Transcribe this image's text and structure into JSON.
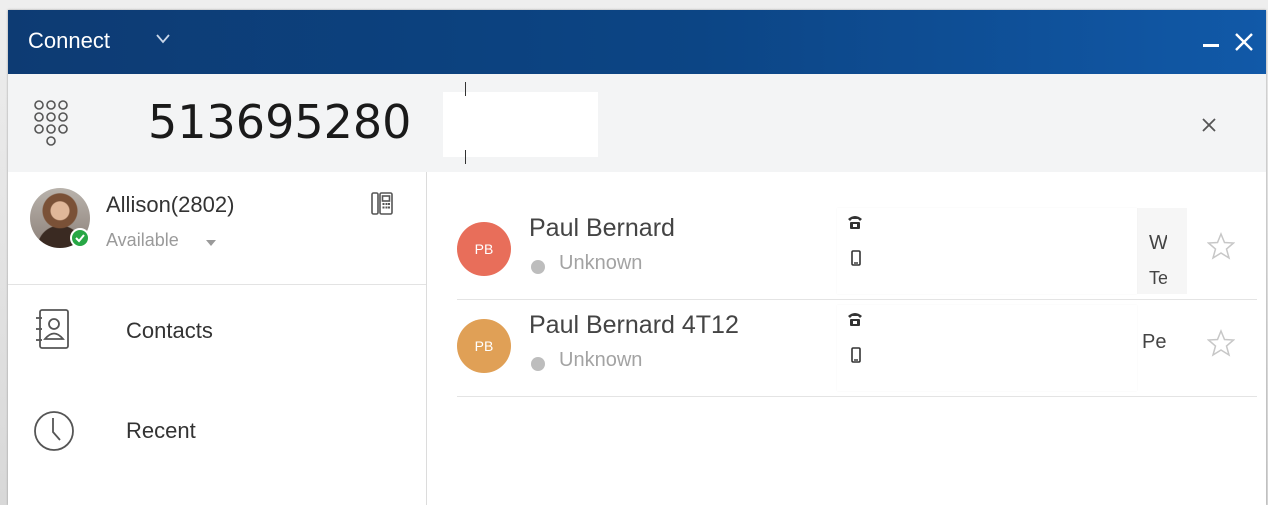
{
  "titlebar": {
    "title": "Connect"
  },
  "dial": {
    "number": "513695280"
  },
  "profile": {
    "name": "Allison(2802)",
    "status": "Available"
  },
  "nav": {
    "contacts_label": "Contacts",
    "recent_label": "Recent"
  },
  "results": [
    {
      "initials": "PB",
      "name": "Paul Bernard",
      "status": "Unknown",
      "avatar_color": "#e86e5a",
      "right_line1": "W",
      "right_line2": "Te"
    },
    {
      "initials": "PB",
      "name": "Paul Bernard 4T12",
      "status": "Unknown",
      "avatar_color": "#e0a056",
      "right_line1": "Pers"
    }
  ],
  "colors": {
    "titlebar": "#0d3b73",
    "available": "#27a745",
    "unknown": "#bdbdbd"
  }
}
